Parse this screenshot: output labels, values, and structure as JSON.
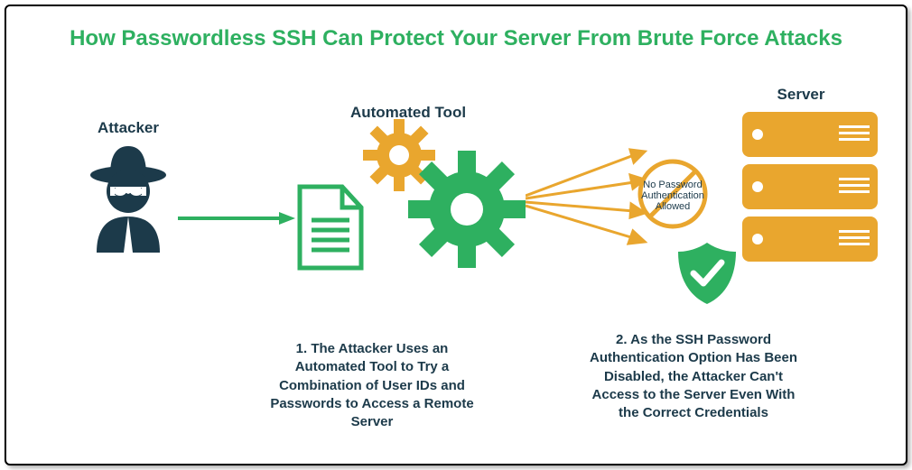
{
  "title": "How Passwordless SSH Can Protect Your Server From Brute Force Attacks",
  "labels": {
    "attacker": "Attacker",
    "tool": "Automated Tool",
    "server": "Server"
  },
  "nopass": "No Password Authentication Allowed",
  "captions": {
    "step1": "1. The Attacker Uses an Automated Tool to Try a Combination of User IDs and Passwords to Access a Remote Server",
    "step2": "2. As the SSH Password Authentication Option Has Been Disabled, the Attacker Can't Access to the Server Even With the Correct Credentials"
  },
  "colors": {
    "green": "#2eb060",
    "amber": "#e9a62e",
    "dark": "#1c3a4a"
  }
}
